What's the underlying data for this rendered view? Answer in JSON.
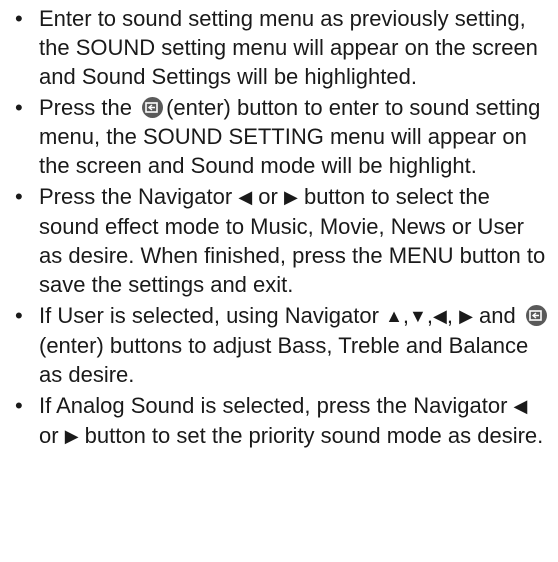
{
  "bullet_glyph": "•",
  "icons": {
    "enter": "enter-button-icon",
    "left": "◀",
    "right": "▶",
    "up": "▲",
    "down": "▼"
  },
  "items": [
    {
      "text": "Enter to sound setting menu as previously setting, the SOUND setting menu will appear on the screen and Sound Settings will be highlighted."
    },
    {
      "a": "Press the",
      "b": "(enter) button to enter to sound setting menu, the SOUND SETTING menu will appear on the screen and Sound mode will be highlight."
    },
    {
      "a": "Press the Navigator",
      "b": "or",
      "c": "button to select the sound effect mode to Music, Movie, News or User as desire. When finished, press the MENU button to save the settings and exit."
    },
    {
      "a": "If User is selected, using Navigator",
      "sep1": ",",
      "sep2": ",",
      "sep3": ",",
      "b": "and",
      "c": "(enter) buttons to adjust Bass, Treble and Balance as desire."
    },
    {
      "a": "If Analog Sound is selected, press the Navigator",
      "b": "or",
      "c": "button to set the priority sound mode as desire."
    }
  ]
}
